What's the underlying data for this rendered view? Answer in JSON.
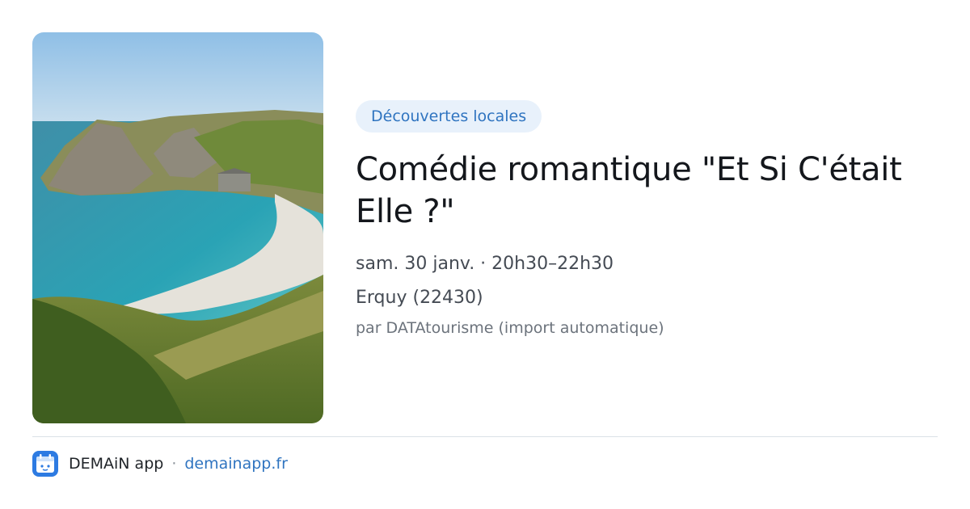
{
  "card": {
    "image_alt": "Coastal cove with turquoise water, pebble beach and grassy cliffs",
    "category": "Découvertes locales",
    "title": "Comédie romantique \"Et Si C'était Elle ?\"",
    "datetime": "sam. 30 janv. · 20h30–22h30",
    "location": "Erquy (22430)",
    "source": "par DATAtourisme (import automatique)"
  },
  "footer": {
    "app_icon": "calendar-cat-icon",
    "app_name": "DEMAiN app",
    "separator": "·",
    "domain": "demainapp.fr"
  },
  "colors": {
    "accent": "#2f74c0",
    "tag_bg": "#e8f1fb",
    "title": "#14171c",
    "app_icon_bg": "#2d7be2"
  }
}
